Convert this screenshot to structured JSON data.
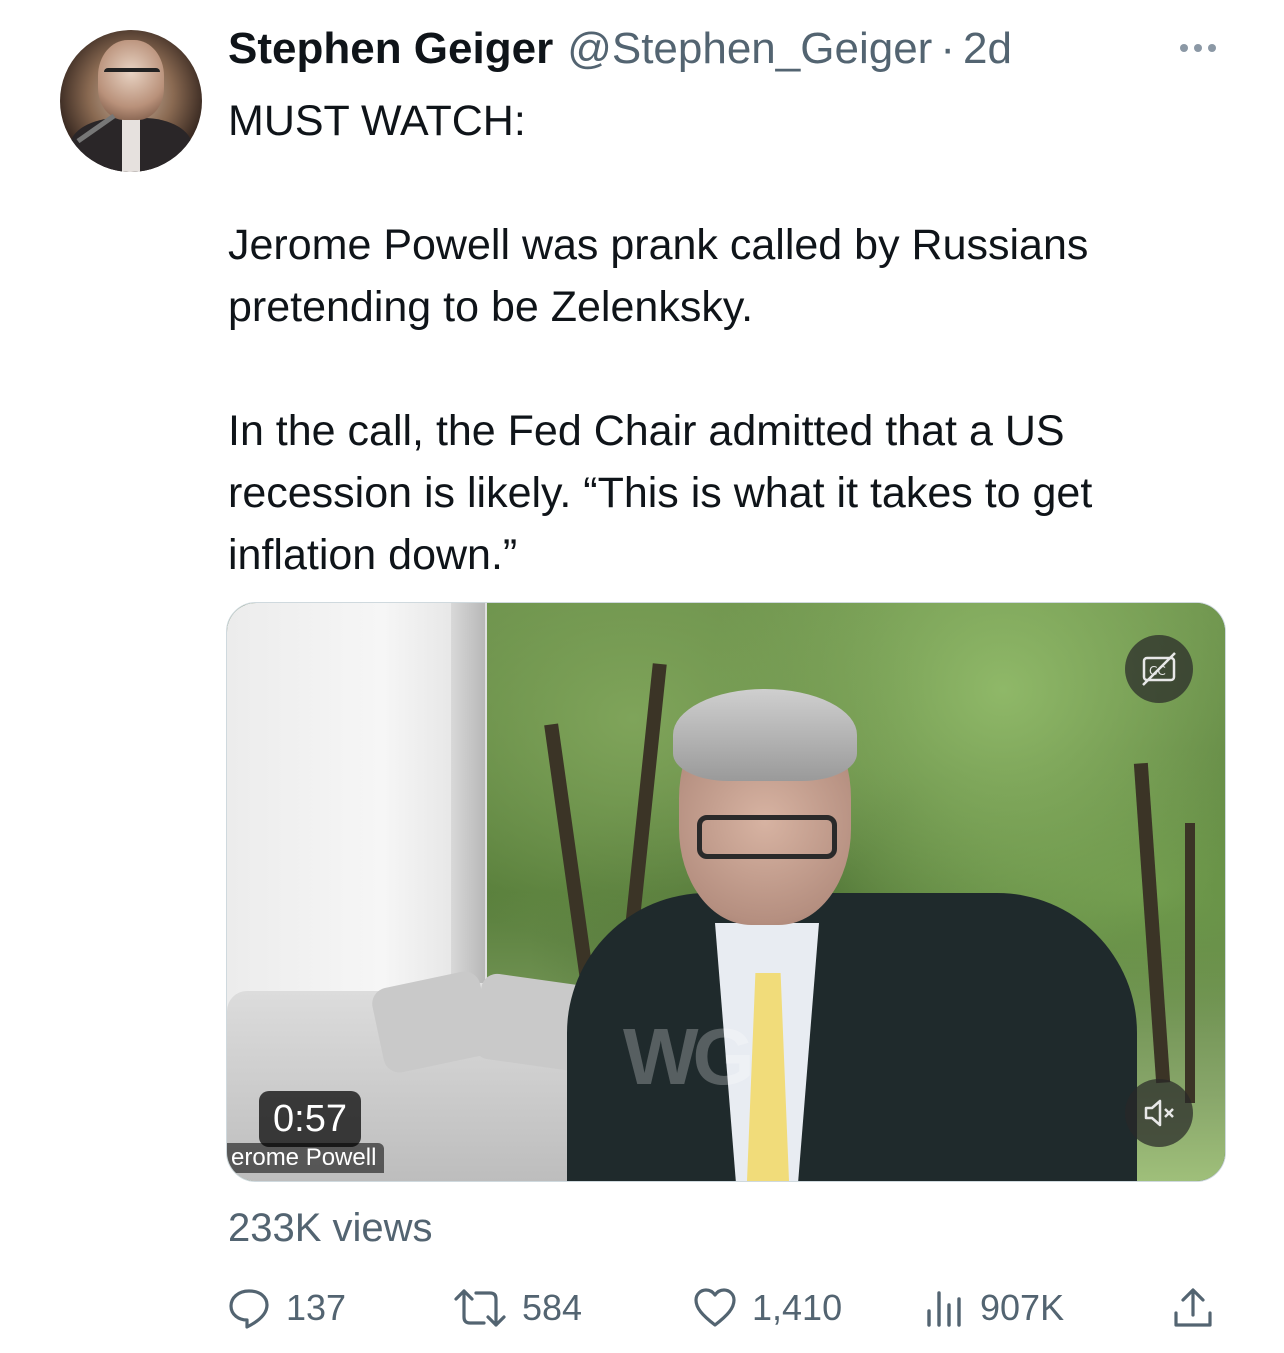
{
  "tweet": {
    "author_name": "Stephen Geiger",
    "author_handle": "@Stephen_Geiger",
    "separator": "·",
    "time": "2d",
    "text_line_1": "MUST WATCH:",
    "text_para_2": "Jerome Powell was prank called by Russians pretending to be Zelenksky.",
    "text_para_3": "In the call, the Fed Chair admitted that a US recession is likely. “This is what it takes to get inflation down.”"
  },
  "media": {
    "duration": "0:57",
    "caption": "erome Powell",
    "watermark": "WG",
    "icons": [
      "closed-captions-icon",
      "muted-speaker-icon"
    ]
  },
  "stats": {
    "views": "233K views",
    "replies": "137",
    "reposts": "584",
    "likes": "1,410",
    "analytics": "907K"
  },
  "colors": {
    "text": "#0f1419",
    "secondary": "#536471"
  }
}
